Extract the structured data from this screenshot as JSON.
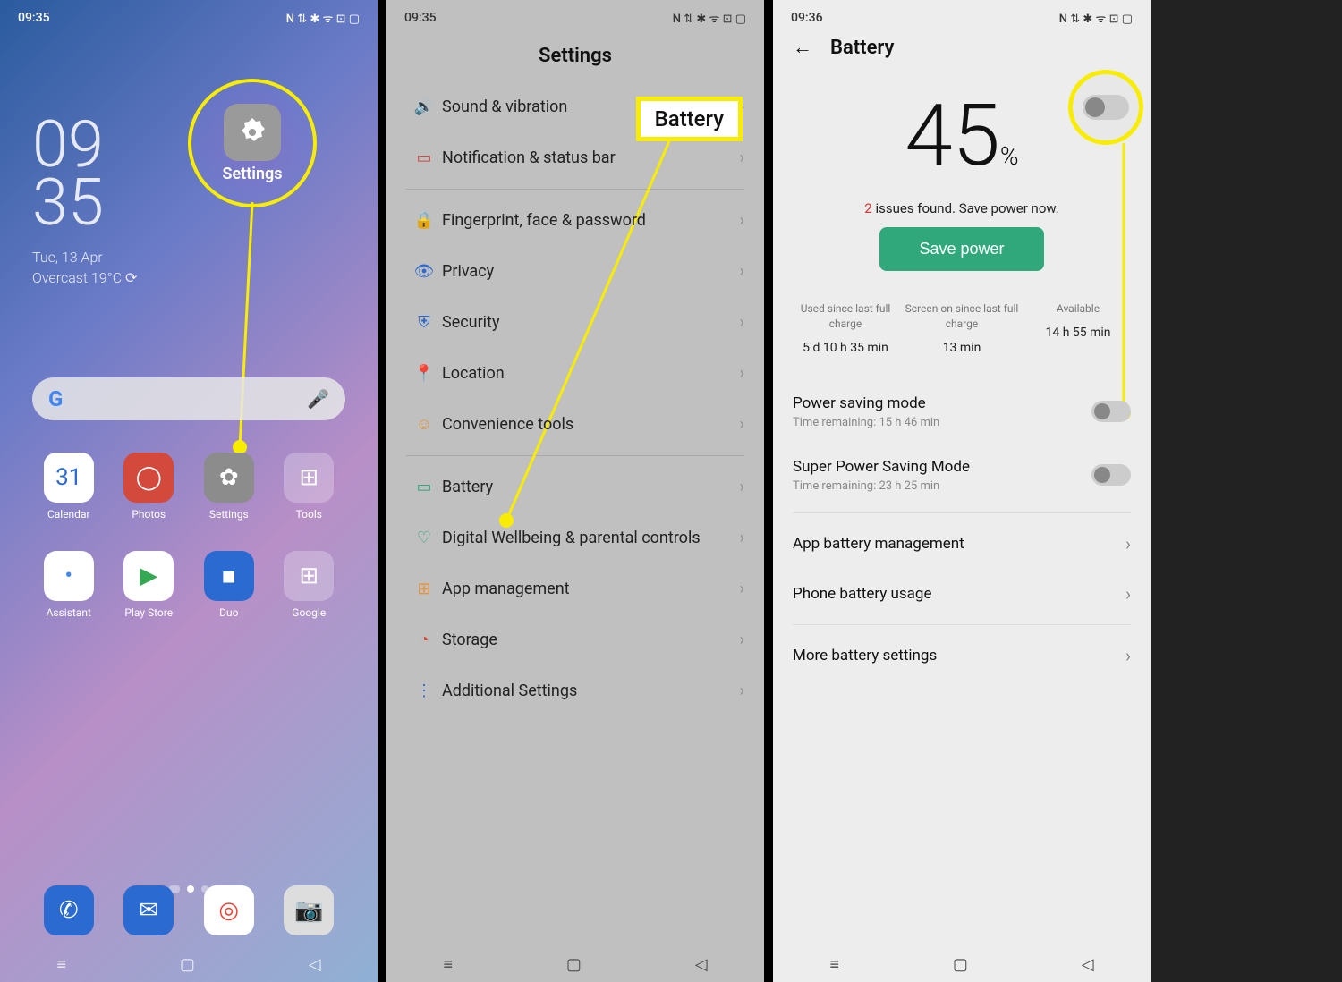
{
  "panel1": {
    "status": {
      "time": "09:35",
      "icons": "N ⇅ ✱ ᯤ ⊡ ▢"
    },
    "clock": {
      "hours": "09",
      "mins": "35"
    },
    "date": "Tue, 13 Apr",
    "weather": "Overcast 19°C  ⟳",
    "callout": {
      "label": "Settings"
    },
    "apps_row1": [
      {
        "name": "calendar",
        "label": "Calendar",
        "bg": "#fff",
        "glyph": "31",
        "color": "#2b6bd1"
      },
      {
        "name": "photos",
        "label": "Photos",
        "bg": "#d34a3d",
        "glyph": "◯",
        "color": "#fff"
      },
      {
        "name": "settings",
        "label": "Settings",
        "bg": "#8c8c8c",
        "glyph": "✿",
        "color": "#fff"
      },
      {
        "name": "tools",
        "label": "Tools",
        "bg": "rgba(255,255,255,0.25)",
        "glyph": "⊞",
        "color": "#fff"
      }
    ],
    "apps_row2": [
      {
        "name": "assistant",
        "label": "Assistant",
        "bg": "#fff",
        "glyph": "•",
        "color": "#4285F4"
      },
      {
        "name": "play-store",
        "label": "Play Store",
        "bg": "#fff",
        "glyph": "▶",
        "color": "#34A853"
      },
      {
        "name": "duo",
        "label": "Duo",
        "bg": "#2b6bd1",
        "glyph": "■",
        "color": "#fff"
      },
      {
        "name": "google",
        "label": "Google",
        "bg": "rgba(255,255,255,0.25)",
        "glyph": "⊞",
        "color": "#fff"
      }
    ],
    "dock": [
      {
        "name": "phone",
        "bg": "#2b6bd1",
        "glyph": "✆",
        "color": "#fff"
      },
      {
        "name": "messages",
        "bg": "#2b6bd1",
        "glyph": "✉",
        "color": "#fff"
      },
      {
        "name": "chrome",
        "bg": "#fff",
        "glyph": "◎",
        "color": "#EA4335"
      },
      {
        "name": "camera",
        "bg": "#ddd",
        "glyph": "📷",
        "color": "#333"
      }
    ]
  },
  "panel2": {
    "status": {
      "time": "09:35",
      "icons": "N ⇅ ✱ ᯤ ⊡ ▢"
    },
    "title": "Settings",
    "tag": "Battery",
    "items": [
      {
        "icon": "🔊",
        "color": "#4caf50",
        "label": "Sound & vibration"
      },
      {
        "icon": "▭",
        "color": "#d34a3d",
        "label": "Notification & status bar"
      },
      {
        "sep": true
      },
      {
        "icon": "🔒",
        "color": "#2b6bd1",
        "label": "Fingerprint, face & password"
      },
      {
        "icon": "👁",
        "color": "#2b6bd1",
        "label": "Privacy"
      },
      {
        "icon": "⛨",
        "color": "#2b6bd1",
        "label": "Security"
      },
      {
        "icon": "📍",
        "color": "#e2933c",
        "label": "Location"
      },
      {
        "icon": "☺",
        "color": "#e2933c",
        "label": "Convenience tools"
      },
      {
        "sep": true
      },
      {
        "icon": "▭",
        "color": "#30a87c",
        "label": "Battery"
      },
      {
        "icon": "♡",
        "color": "#30a87c",
        "label": "Digital Wellbeing & parental controls"
      },
      {
        "icon": "⊞",
        "color": "#e2933c",
        "label": "App management"
      },
      {
        "icon": "◔",
        "color": "#d34a3d",
        "label": "Storage"
      },
      {
        "icon": "⋮",
        "color": "#2b6bd1",
        "label": "Additional Settings"
      }
    ]
  },
  "panel3": {
    "status": {
      "time": "09:36",
      "icons": "N ⇅ ✱ ᯤ ⊡ ▢"
    },
    "title": "Battery",
    "pct": "45",
    "pct_sym": "%",
    "issues": {
      "n": "2",
      "text": " issues found. Save power now."
    },
    "save_btn": "Save power",
    "stats": [
      {
        "label": "Used since last full charge",
        "value": "5 d 10 h 35 min"
      },
      {
        "label": "Screen on since last full charge",
        "value": "13 min"
      },
      {
        "label": "Available",
        "value": "14 h 55 min"
      }
    ],
    "rows": [
      {
        "title": "Power saving mode",
        "sub": "Time remaining:  15 h 46 min",
        "toggle": true
      },
      {
        "title": "Super Power Saving Mode",
        "sub": "Time remaining:  23 h 25 min",
        "toggle": true
      },
      {
        "sep": true
      },
      {
        "title": "App battery management",
        "chev": true
      },
      {
        "title": "Phone battery usage",
        "chev": true
      },
      {
        "sep": true
      },
      {
        "title": "More battery settings",
        "chev": true
      }
    ]
  }
}
